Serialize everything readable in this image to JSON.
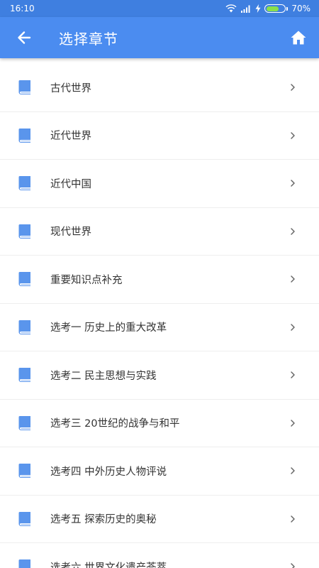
{
  "status_bar": {
    "time": "16:10",
    "battery_percent": "70%",
    "battery_level": 0.7
  },
  "app_bar": {
    "title": "选择章节",
    "back_icon": "arrow-left-icon",
    "home_icon": "home-icon"
  },
  "chapters": [
    {
      "label": "古代世界"
    },
    {
      "label": "近代世界"
    },
    {
      "label": "近代中国"
    },
    {
      "label": "现代世界"
    },
    {
      "label": "重要知识点补充"
    },
    {
      "label": "选考一 历史上的重大改革"
    },
    {
      "label": "选考二 民主思想与实践"
    },
    {
      "label": "选考三 20世纪的战争与和平"
    },
    {
      "label": "选考四 中外历史人物评说"
    },
    {
      "label": "选考五 探索历史的奥秘"
    },
    {
      "label": "选考六 世界文化遗产荟萃"
    }
  ],
  "colors": {
    "status_bar": "#3f7fe0",
    "app_bar": "#4b8cf0",
    "book_icon": "#5a95ec",
    "text": "#333333",
    "divider": "#eeeeee"
  }
}
